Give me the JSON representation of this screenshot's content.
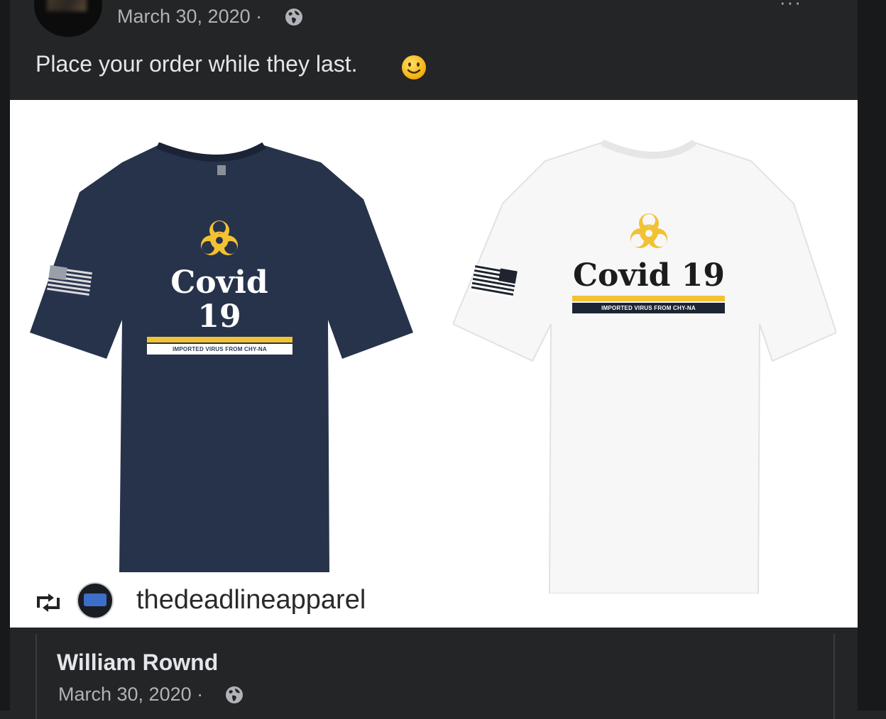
{
  "post": {
    "date": "March 30, 2020 ·",
    "text": "Place your order while they last.",
    "more": "···",
    "icons": {
      "visibility": "globe-icon",
      "emoji": "smiling-face-icon",
      "menu": "more-options-icon"
    }
  },
  "image": {
    "shirts": [
      {
        "color": "navy",
        "title": "Covid 19",
        "slogan": "IMPORTED VIRUS FROM CHY-NA"
      },
      {
        "color": "white",
        "title": "Covid 19",
        "slogan": "IMPORTED VIRUS FROM CHY-NA"
      }
    ],
    "repost": {
      "account": "thedeadlineapparel",
      "icon": "repost-icon"
    }
  },
  "comment": {
    "author": "William Rownd",
    "date": "March 30, 2020 ·"
  },
  "colors": {
    "background": "#242526",
    "accent_yellow": "#f2c233",
    "navy_shirt": "#27334a"
  }
}
